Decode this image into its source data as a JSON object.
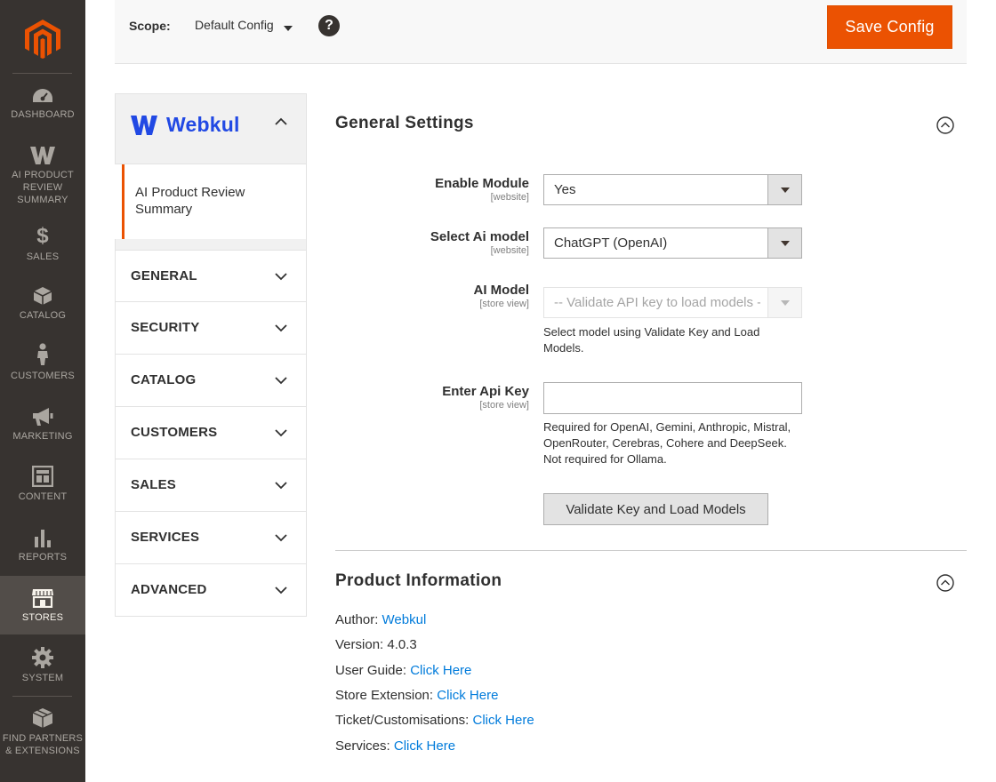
{
  "sidebar": {
    "items": [
      {
        "label": "Dashboard",
        "icon": "dashboard-icon"
      },
      {
        "label": "AI Product Review Summary",
        "icon": "webkul-w-icon"
      },
      {
        "label": "Sales",
        "icon": "dollar-icon"
      },
      {
        "label": "Catalog",
        "icon": "box-icon"
      },
      {
        "label": "Customers",
        "icon": "person-icon"
      },
      {
        "label": "Marketing",
        "icon": "megaphone-icon"
      },
      {
        "label": "Content",
        "icon": "layout-icon"
      },
      {
        "label": "Reports",
        "icon": "bar-chart-icon"
      },
      {
        "label": "Stores",
        "icon": "storefront-icon"
      },
      {
        "label": "System",
        "icon": "gear-icon"
      },
      {
        "label": "Find Partners & Extensions",
        "icon": "blocks-icon"
      }
    ],
    "active": "Stores"
  },
  "header": {
    "scope_label": "Scope:",
    "scope_value": "Default Config",
    "help": "?",
    "save_label": "Save Config"
  },
  "tabs": {
    "vendor": "Webkul",
    "vendor_item": "AI Product Review Summary",
    "items": [
      "GENERAL",
      "SECURITY",
      "CATALOG",
      "CUSTOMERS",
      "SALES",
      "SERVICES",
      "ADVANCED"
    ]
  },
  "general": {
    "title": "General Settings",
    "enable_module": {
      "label": "Enable Module",
      "scope": "[website]",
      "value": "Yes"
    },
    "ai_model_select": {
      "label": "Select Ai model",
      "scope": "[website]",
      "value": "ChatGPT (OpenAI)"
    },
    "ai_model": {
      "label": "AI Model",
      "scope": "[store view]",
      "value": "-- Validate API key to load models --",
      "note": "Select model using Validate Key and Load Models."
    },
    "api_key": {
      "label": "Enter Api Key",
      "scope": "[store view]",
      "value": "",
      "note": "Required for OpenAI, Gemini, Anthropic, Mistral, OpenRouter, Cerebras, Cohere and DeepSeek. Not required for Ollama."
    },
    "validate_label": "Validate Key and Load Models"
  },
  "product_info": {
    "title": "Product Information",
    "author_label": "Author:",
    "author_link": "Webkul",
    "version": "Version: 4.0.3",
    "user_guide_label": "User Guide:",
    "store_extension_label": "Store Extension:",
    "ticket_label": "Ticket/Customisations:",
    "services_label": "Services:",
    "link_text": "Click Here"
  },
  "colors": {
    "sidebar_bg": "#373330",
    "accent": "#eb5202",
    "link": "#007bdb",
    "webkul_blue": "#2149e4"
  }
}
